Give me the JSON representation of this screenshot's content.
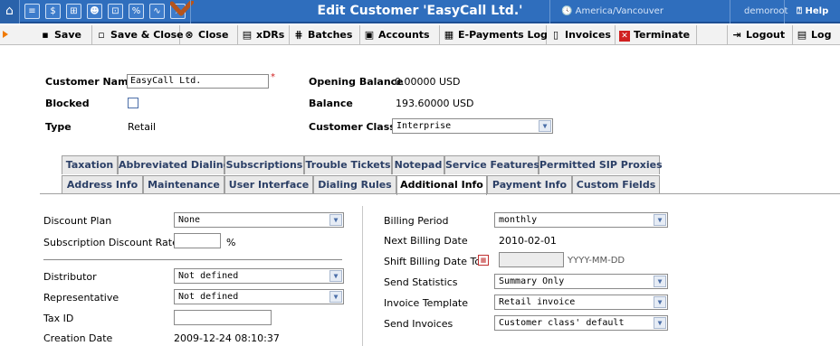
{
  "window": {
    "title": "Edit Customer 'EasyCall Ltd.'",
    "timezone": "America/Vancouver",
    "user": "demoroot",
    "help": "Help"
  },
  "topbar_icons": [
    "home-icon",
    "list-icon",
    "dollar-icon",
    "grid-icon",
    "person-icon",
    "tree-icon",
    "rates-icon",
    "chart-icon",
    "search-icon"
  ],
  "toolbar": {
    "save": "Save",
    "save_close": "Save & Close",
    "close": "Close",
    "xdrs": "xDRs",
    "batches": "Batches",
    "accounts": "Accounts",
    "epayments": "E-Payments Log",
    "invoices": "Invoices",
    "terminate": "Terminate",
    "logout": "Logout",
    "log": "Log"
  },
  "customer": {
    "name_label": "Customer Name",
    "name_value": "EasyCall Ltd.",
    "blocked_label": "Blocked",
    "type_label": "Type",
    "type_value": "Retail",
    "opening_balance_label": "Opening Balance",
    "opening_balance_value": "0.00000 USD",
    "balance_label": "Balance",
    "balance_value": "193.60000 USD",
    "class_label": "Customer Class",
    "class_value": "Interprise"
  },
  "tabs_row1": [
    "Taxation",
    "Abbreviated Dialing",
    "Subscriptions",
    "Trouble Tickets",
    "Notepad",
    "Service Features",
    "Permitted SIP Proxies"
  ],
  "tabs_row2": [
    "Address Info",
    "Maintenance",
    "User Interface",
    "Dialing Rules",
    "Additional Info",
    "Payment Info",
    "Custom Fields"
  ],
  "left": {
    "discount_plan_label": "Discount Plan",
    "discount_plan_value": "None",
    "sub_discount_label": "Subscription Discount Rate",
    "sub_discount_value": "",
    "percent": "%",
    "distributor_label": "Distributor",
    "distributor_value": "Not defined",
    "representative_label": "Representative",
    "representative_value": "Not defined",
    "taxid_label": "Tax ID",
    "taxid_value": "",
    "creation_label": "Creation Date",
    "creation_value": "2009-12-24 08:10:37"
  },
  "right": {
    "billing_period_label": "Billing Period",
    "billing_period_value": "monthly",
    "next_billing_label": "Next Billing Date",
    "next_billing_value": "2010-02-01",
    "shift_label": "Shift Billing Date To",
    "shift_value": "",
    "shift_hint": "YYYY-MM-DD",
    "send_stats_label": "Send Statistics",
    "send_stats_value": "Summary Only",
    "invoice_template_label": "Invoice Template",
    "invoice_template_value": "Retail invoice",
    "send_invoices_label": "Send Invoices",
    "send_invoices_value": "Customer class' default"
  }
}
